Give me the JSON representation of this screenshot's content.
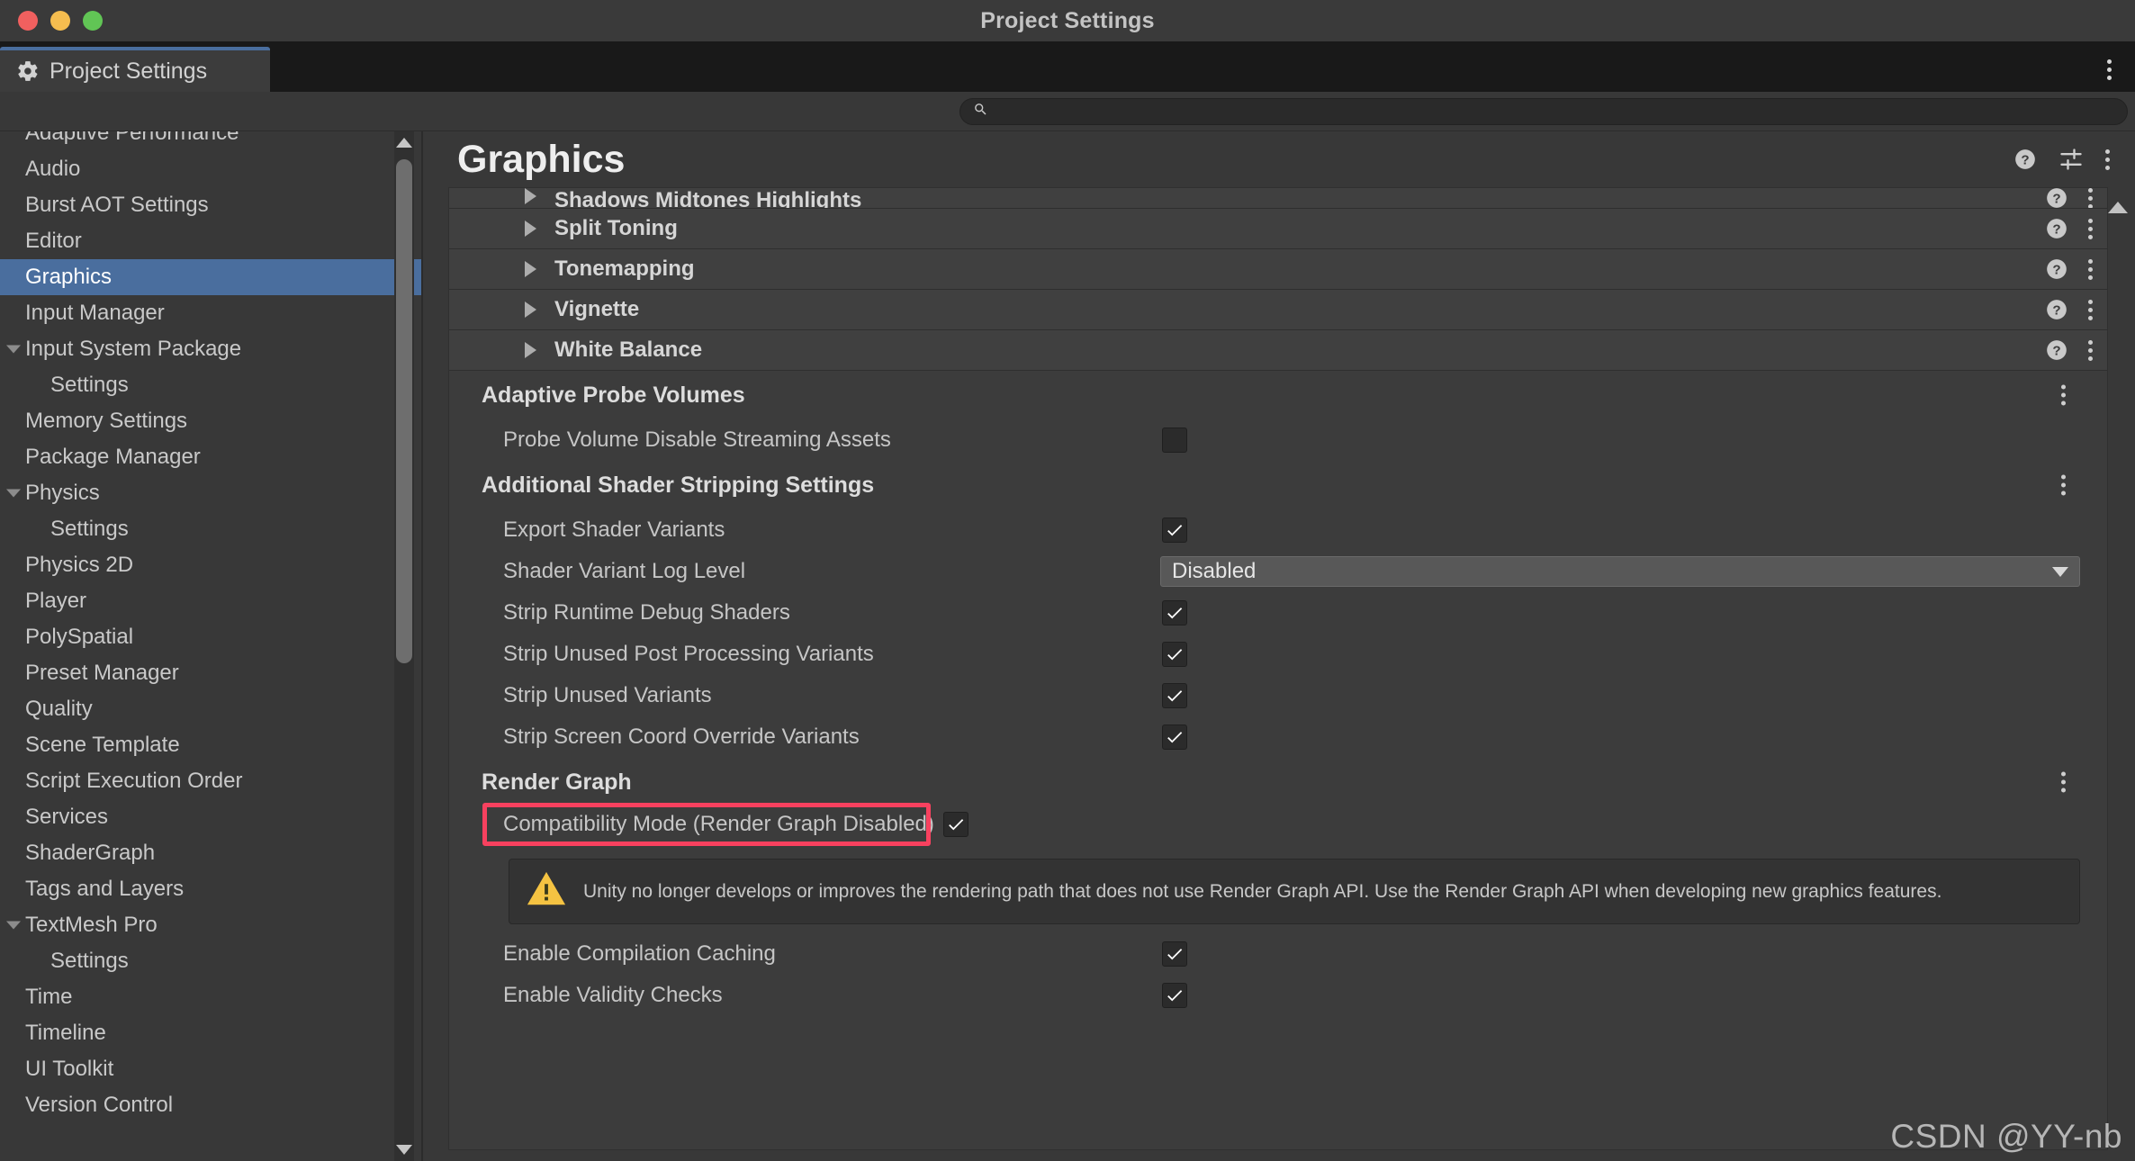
{
  "window": {
    "title": "Project Settings",
    "traffic_lights": [
      "close",
      "minimize",
      "zoom"
    ]
  },
  "tab": {
    "label": "Project Settings",
    "icon": "gear-icon"
  },
  "search": {
    "value": "",
    "placeholder": "",
    "icon": "search-icon"
  },
  "sidebar": {
    "items": [
      {
        "label": "Adaptive Performance",
        "indent": 0,
        "selected": false,
        "clipped": true,
        "arrow": false
      },
      {
        "label": "Audio",
        "indent": 0,
        "selected": false,
        "clipped": false,
        "arrow": false
      },
      {
        "label": "Burst AOT Settings",
        "indent": 0,
        "selected": false,
        "clipped": false,
        "arrow": false
      },
      {
        "label": "Editor",
        "indent": 0,
        "selected": false,
        "clipped": false,
        "arrow": false
      },
      {
        "label": "Graphics",
        "indent": 0,
        "selected": true,
        "clipped": false,
        "arrow": false
      },
      {
        "label": "Input Manager",
        "indent": 0,
        "selected": false,
        "clipped": false,
        "arrow": false
      },
      {
        "label": "Input System Package",
        "indent": 0,
        "selected": false,
        "clipped": false,
        "arrow": true
      },
      {
        "label": "Settings",
        "indent": 1,
        "selected": false,
        "clipped": false,
        "arrow": false
      },
      {
        "label": "Memory Settings",
        "indent": 0,
        "selected": false,
        "clipped": false,
        "arrow": false
      },
      {
        "label": "Package Manager",
        "indent": 0,
        "selected": false,
        "clipped": false,
        "arrow": false
      },
      {
        "label": "Physics",
        "indent": 0,
        "selected": false,
        "clipped": false,
        "arrow": true
      },
      {
        "label": "Settings",
        "indent": 1,
        "selected": false,
        "clipped": false,
        "arrow": false
      },
      {
        "label": "Physics 2D",
        "indent": 0,
        "selected": false,
        "clipped": false,
        "arrow": false
      },
      {
        "label": "Player",
        "indent": 0,
        "selected": false,
        "clipped": false,
        "arrow": false
      },
      {
        "label": "PolySpatial",
        "indent": 0,
        "selected": false,
        "clipped": false,
        "arrow": false
      },
      {
        "label": "Preset Manager",
        "indent": 0,
        "selected": false,
        "clipped": false,
        "arrow": false
      },
      {
        "label": "Quality",
        "indent": 0,
        "selected": false,
        "clipped": false,
        "arrow": false
      },
      {
        "label": "Scene Template",
        "indent": 0,
        "selected": false,
        "clipped": false,
        "arrow": false
      },
      {
        "label": "Script Execution Order",
        "indent": 0,
        "selected": false,
        "clipped": false,
        "arrow": false
      },
      {
        "label": "Services",
        "indent": 0,
        "selected": false,
        "clipped": false,
        "arrow": false
      },
      {
        "label": "ShaderGraph",
        "indent": 0,
        "selected": false,
        "clipped": false,
        "arrow": false
      },
      {
        "label": "Tags and Layers",
        "indent": 0,
        "selected": false,
        "clipped": false,
        "arrow": false
      },
      {
        "label": "TextMesh Pro",
        "indent": 0,
        "selected": false,
        "clipped": false,
        "arrow": true
      },
      {
        "label": "Settings",
        "indent": 1,
        "selected": false,
        "clipped": false,
        "arrow": false
      },
      {
        "label": "Time",
        "indent": 0,
        "selected": false,
        "clipped": false,
        "arrow": false
      },
      {
        "label": "Timeline",
        "indent": 0,
        "selected": false,
        "clipped": false,
        "arrow": false
      },
      {
        "label": "UI Toolkit",
        "indent": 0,
        "selected": false,
        "clipped": false,
        "arrow": false
      },
      {
        "label": "Version Control",
        "indent": 0,
        "selected": false,
        "clipped": false,
        "arrow": false
      }
    ],
    "selected_color": "#4a6e9e"
  },
  "main": {
    "title": "Graphics",
    "header_icons": [
      "help-icon",
      "preset-icon",
      "kebab-menu-icon"
    ],
    "foldouts": [
      {
        "label": "Shadows Midtones Highlights",
        "cut": true
      },
      {
        "label": "Split Toning",
        "cut": false
      },
      {
        "label": "Tonemapping",
        "cut": false
      },
      {
        "label": "Vignette",
        "cut": false
      },
      {
        "label": "White Balance",
        "cut": false
      }
    ],
    "sections": [
      {
        "title": "Adaptive Probe Volumes",
        "rows": [
          {
            "type": "checkbox",
            "label": "Probe Volume Disable Streaming Assets",
            "checked": false
          }
        ]
      },
      {
        "title": "Additional Shader Stripping Settings",
        "rows": [
          {
            "type": "checkbox",
            "label": "Export Shader Variants",
            "checked": true
          },
          {
            "type": "dropdown",
            "label": "Shader Variant Log Level",
            "value": "Disabled"
          },
          {
            "type": "checkbox",
            "label": "Strip Runtime Debug Shaders",
            "checked": true
          },
          {
            "type": "checkbox",
            "label": "Strip Unused Post Processing Variants",
            "checked": true
          },
          {
            "type": "checkbox",
            "label": "Strip Unused Variants",
            "checked": true
          },
          {
            "type": "checkbox",
            "label": "Strip Screen Coord Override Variants",
            "checked": true
          }
        ]
      }
    ],
    "render_graph": {
      "title": "Render Graph",
      "compatibility": {
        "label": "Compatibility Mode (Render Graph Disabled)",
        "checked": true,
        "highlight_color": "#f8415f"
      },
      "warning": {
        "icon": "warning-triangle-icon",
        "text": "Unity no longer develops or improves the rendering path that does not use Render Graph API. Use the Render Graph API when developing new graphics features."
      },
      "rows": [
        {
          "type": "checkbox",
          "label": "Enable Compilation Caching",
          "checked": true
        },
        {
          "type": "checkbox",
          "label": "Enable Validity Checks",
          "checked": true
        }
      ]
    }
  },
  "watermark": "CSDN @YY-nb"
}
